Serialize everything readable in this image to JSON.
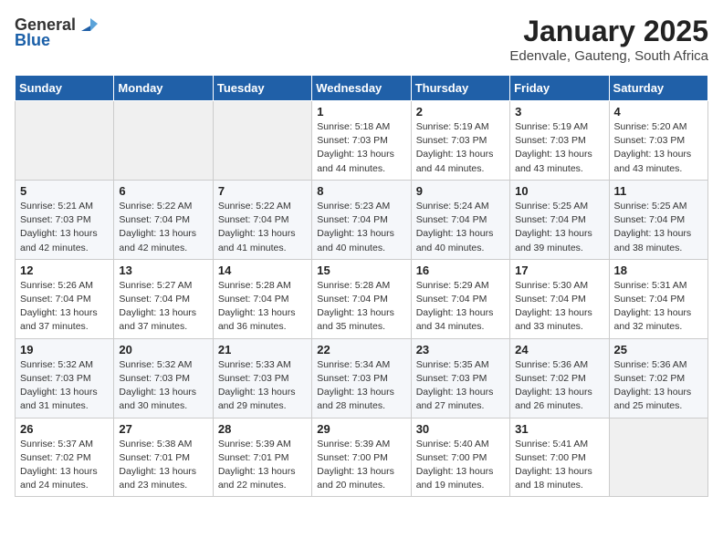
{
  "header": {
    "logo_general": "General",
    "logo_blue": "Blue",
    "month_year": "January 2025",
    "location": "Edenvale, Gauteng, South Africa"
  },
  "days_of_week": [
    "Sunday",
    "Monday",
    "Tuesday",
    "Wednesday",
    "Thursday",
    "Friday",
    "Saturday"
  ],
  "weeks": [
    [
      {
        "day": null,
        "info": null
      },
      {
        "day": null,
        "info": null
      },
      {
        "day": null,
        "info": null
      },
      {
        "day": "1",
        "info": "Sunrise: 5:18 AM\nSunset: 7:03 PM\nDaylight: 13 hours\nand 44 minutes."
      },
      {
        "day": "2",
        "info": "Sunrise: 5:19 AM\nSunset: 7:03 PM\nDaylight: 13 hours\nand 44 minutes."
      },
      {
        "day": "3",
        "info": "Sunrise: 5:19 AM\nSunset: 7:03 PM\nDaylight: 13 hours\nand 43 minutes."
      },
      {
        "day": "4",
        "info": "Sunrise: 5:20 AM\nSunset: 7:03 PM\nDaylight: 13 hours\nand 43 minutes."
      }
    ],
    [
      {
        "day": "5",
        "info": "Sunrise: 5:21 AM\nSunset: 7:03 PM\nDaylight: 13 hours\nand 42 minutes."
      },
      {
        "day": "6",
        "info": "Sunrise: 5:22 AM\nSunset: 7:04 PM\nDaylight: 13 hours\nand 42 minutes."
      },
      {
        "day": "7",
        "info": "Sunrise: 5:22 AM\nSunset: 7:04 PM\nDaylight: 13 hours\nand 41 minutes."
      },
      {
        "day": "8",
        "info": "Sunrise: 5:23 AM\nSunset: 7:04 PM\nDaylight: 13 hours\nand 40 minutes."
      },
      {
        "day": "9",
        "info": "Sunrise: 5:24 AM\nSunset: 7:04 PM\nDaylight: 13 hours\nand 40 minutes."
      },
      {
        "day": "10",
        "info": "Sunrise: 5:25 AM\nSunset: 7:04 PM\nDaylight: 13 hours\nand 39 minutes."
      },
      {
        "day": "11",
        "info": "Sunrise: 5:25 AM\nSunset: 7:04 PM\nDaylight: 13 hours\nand 38 minutes."
      }
    ],
    [
      {
        "day": "12",
        "info": "Sunrise: 5:26 AM\nSunset: 7:04 PM\nDaylight: 13 hours\nand 37 minutes."
      },
      {
        "day": "13",
        "info": "Sunrise: 5:27 AM\nSunset: 7:04 PM\nDaylight: 13 hours\nand 37 minutes."
      },
      {
        "day": "14",
        "info": "Sunrise: 5:28 AM\nSunset: 7:04 PM\nDaylight: 13 hours\nand 36 minutes."
      },
      {
        "day": "15",
        "info": "Sunrise: 5:28 AM\nSunset: 7:04 PM\nDaylight: 13 hours\nand 35 minutes."
      },
      {
        "day": "16",
        "info": "Sunrise: 5:29 AM\nSunset: 7:04 PM\nDaylight: 13 hours\nand 34 minutes."
      },
      {
        "day": "17",
        "info": "Sunrise: 5:30 AM\nSunset: 7:04 PM\nDaylight: 13 hours\nand 33 minutes."
      },
      {
        "day": "18",
        "info": "Sunrise: 5:31 AM\nSunset: 7:04 PM\nDaylight: 13 hours\nand 32 minutes."
      }
    ],
    [
      {
        "day": "19",
        "info": "Sunrise: 5:32 AM\nSunset: 7:03 PM\nDaylight: 13 hours\nand 31 minutes."
      },
      {
        "day": "20",
        "info": "Sunrise: 5:32 AM\nSunset: 7:03 PM\nDaylight: 13 hours\nand 30 minutes."
      },
      {
        "day": "21",
        "info": "Sunrise: 5:33 AM\nSunset: 7:03 PM\nDaylight: 13 hours\nand 29 minutes."
      },
      {
        "day": "22",
        "info": "Sunrise: 5:34 AM\nSunset: 7:03 PM\nDaylight: 13 hours\nand 28 minutes."
      },
      {
        "day": "23",
        "info": "Sunrise: 5:35 AM\nSunset: 7:03 PM\nDaylight: 13 hours\nand 27 minutes."
      },
      {
        "day": "24",
        "info": "Sunrise: 5:36 AM\nSunset: 7:02 PM\nDaylight: 13 hours\nand 26 minutes."
      },
      {
        "day": "25",
        "info": "Sunrise: 5:36 AM\nSunset: 7:02 PM\nDaylight: 13 hours\nand 25 minutes."
      }
    ],
    [
      {
        "day": "26",
        "info": "Sunrise: 5:37 AM\nSunset: 7:02 PM\nDaylight: 13 hours\nand 24 minutes."
      },
      {
        "day": "27",
        "info": "Sunrise: 5:38 AM\nSunset: 7:01 PM\nDaylight: 13 hours\nand 23 minutes."
      },
      {
        "day": "28",
        "info": "Sunrise: 5:39 AM\nSunset: 7:01 PM\nDaylight: 13 hours\nand 22 minutes."
      },
      {
        "day": "29",
        "info": "Sunrise: 5:39 AM\nSunset: 7:00 PM\nDaylight: 13 hours\nand 20 minutes."
      },
      {
        "day": "30",
        "info": "Sunrise: 5:40 AM\nSunset: 7:00 PM\nDaylight: 13 hours\nand 19 minutes."
      },
      {
        "day": "31",
        "info": "Sunrise: 5:41 AM\nSunset: 7:00 PM\nDaylight: 13 hours\nand 18 minutes."
      },
      {
        "day": null,
        "info": null
      }
    ]
  ]
}
